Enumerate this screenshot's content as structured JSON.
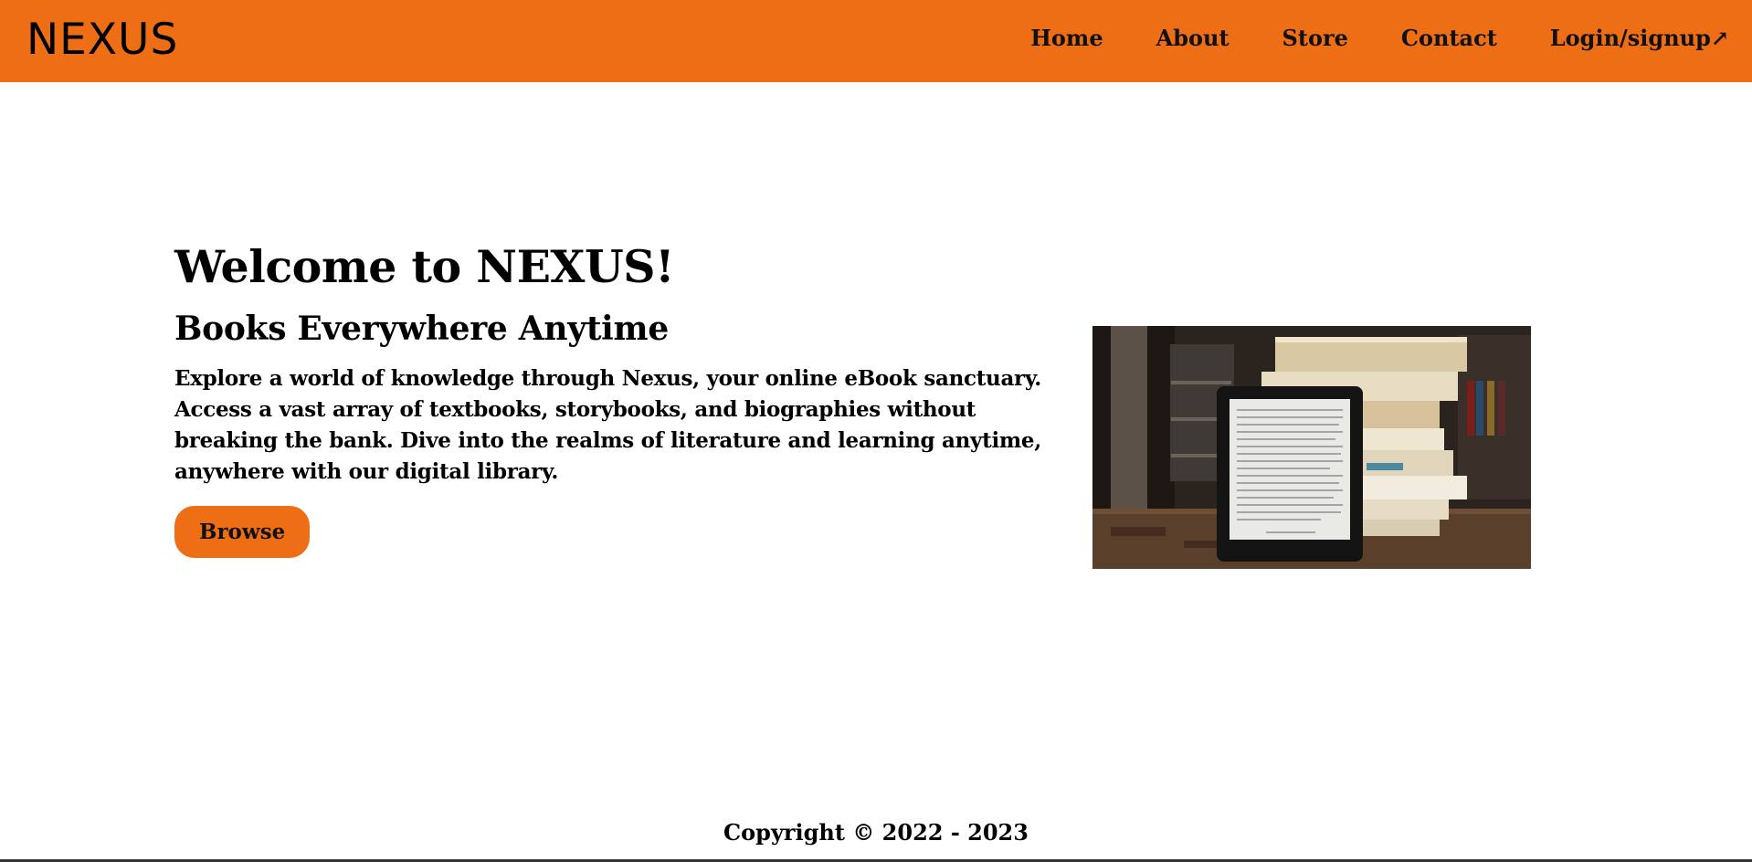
{
  "header": {
    "logo": "NEXUS",
    "nav": [
      {
        "label": "Home"
      },
      {
        "label": "About"
      },
      {
        "label": "Store"
      },
      {
        "label": "Contact"
      },
      {
        "label": "Login/signup↗"
      }
    ]
  },
  "hero": {
    "title": "Welcome to NEXUS!",
    "subtitle": "Books Everywhere Anytime",
    "description": "Explore a world of knowledge through Nexus, your online eBook sanctuary. Access a vast array of textbooks, storybooks, and biographies without breaking the bank. Dive into the realms of literature and learning anytime, anywhere with our digital library.",
    "button_label": "Browse",
    "image_icon": "ebook-reader-with-book-stack-image"
  },
  "footer": {
    "copyright": "Copyright © 2022 - 2023"
  },
  "colors": {
    "accent": "#ee6e15",
    "text": "#000000",
    "background": "#ffffff"
  }
}
